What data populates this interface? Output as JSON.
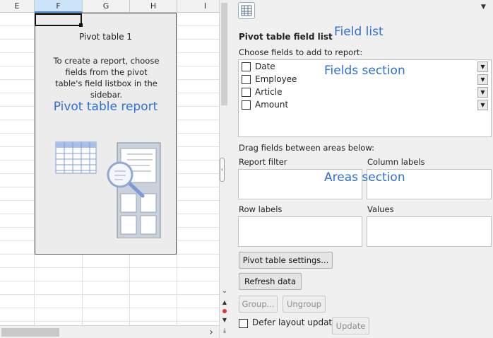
{
  "sheet": {
    "columns": [
      "E",
      "F",
      "G",
      "H",
      "I"
    ],
    "selected_column": "F",
    "pivot": {
      "title": "Pivot table 1",
      "hint": "To create a report, choose fields from the pivot table's field listbox in the sidebar.",
      "annotation": "Pivot table report"
    }
  },
  "sidebar": {
    "title": "Pivot table field list",
    "annotations": {
      "field_list": "Field list",
      "fields_section": "Fields section",
      "areas_section": "Areas section"
    },
    "choose_label": "Choose fields to add to report:",
    "fields": [
      {
        "name": "Date",
        "checked": false
      },
      {
        "name": "Employee",
        "checked": false
      },
      {
        "name": "Article",
        "checked": false
      },
      {
        "name": "Amount",
        "checked": false
      }
    ],
    "drag_label": "Drag fields between areas below:",
    "areas": {
      "report_filter": "Report filter",
      "column_labels": "Column labels",
      "row_labels": "Row labels",
      "values": "Values"
    },
    "buttons": {
      "settings": "Pivot table settings...",
      "refresh": "Refresh data",
      "group": "Group...",
      "ungroup": "Ungroup",
      "update": "Update"
    },
    "defer_label": "Defer layout update",
    "defer_checked": false
  },
  "colors": {
    "annotation": "#2f6fd6",
    "selected_column_bg": "#cde3f7",
    "pivot_bg": "#ececec",
    "sidebar_bg": "#f0f0f0"
  }
}
